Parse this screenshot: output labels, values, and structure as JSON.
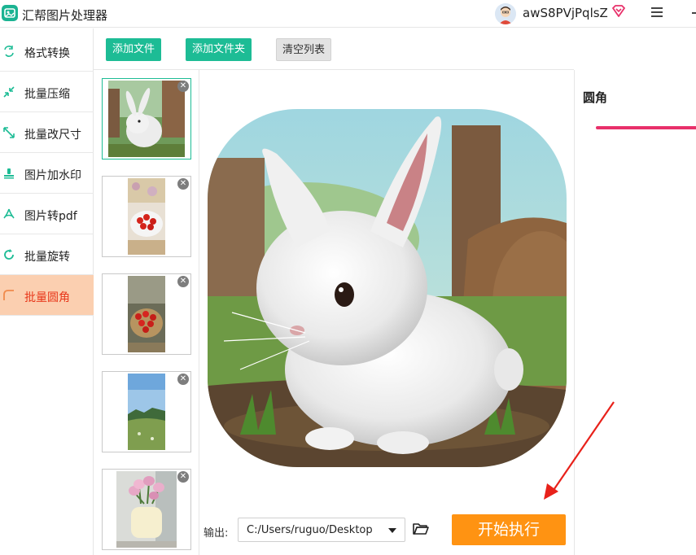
{
  "app": {
    "title": "汇帮图片处理器",
    "username": "awS8PVjPqlsZ",
    "colors": {
      "accent_green": "#1dbc95",
      "active_bg": "#fbcfb0",
      "active_text": "#e8371a",
      "start_button": "#ff9312",
      "slider": "#e8306a"
    }
  },
  "sidebar": {
    "items": [
      {
        "label": "格式转换",
        "icon": "format-convert-icon"
      },
      {
        "label": "批量压缩",
        "icon": "compress-icon"
      },
      {
        "label": "批量改尺寸",
        "icon": "resize-icon"
      },
      {
        "label": "图片加水印",
        "icon": "watermark-icon"
      },
      {
        "label": "图片转pdf",
        "icon": "pdf-icon"
      },
      {
        "label": "批量旋转",
        "icon": "rotate-icon"
      },
      {
        "label": "批量圆角",
        "icon": "round-corner-icon",
        "active": true
      }
    ]
  },
  "toolbar": {
    "add_file": "添加文件",
    "add_folder": "添加文件夹",
    "clear_list": "清空列表"
  },
  "thumbnails": [
    {
      "subject": "rabbit",
      "selected": true
    },
    {
      "subject": "strawberry-plate"
    },
    {
      "subject": "strawberry-basket"
    },
    {
      "subject": "hill-landscape"
    },
    {
      "subject": "tulip-vase"
    }
  ],
  "output": {
    "label": "输出:",
    "path": "C:/Users/ruguo/Desktop"
  },
  "start_button": "开始执行",
  "right_panel": {
    "title": "圆角"
  }
}
